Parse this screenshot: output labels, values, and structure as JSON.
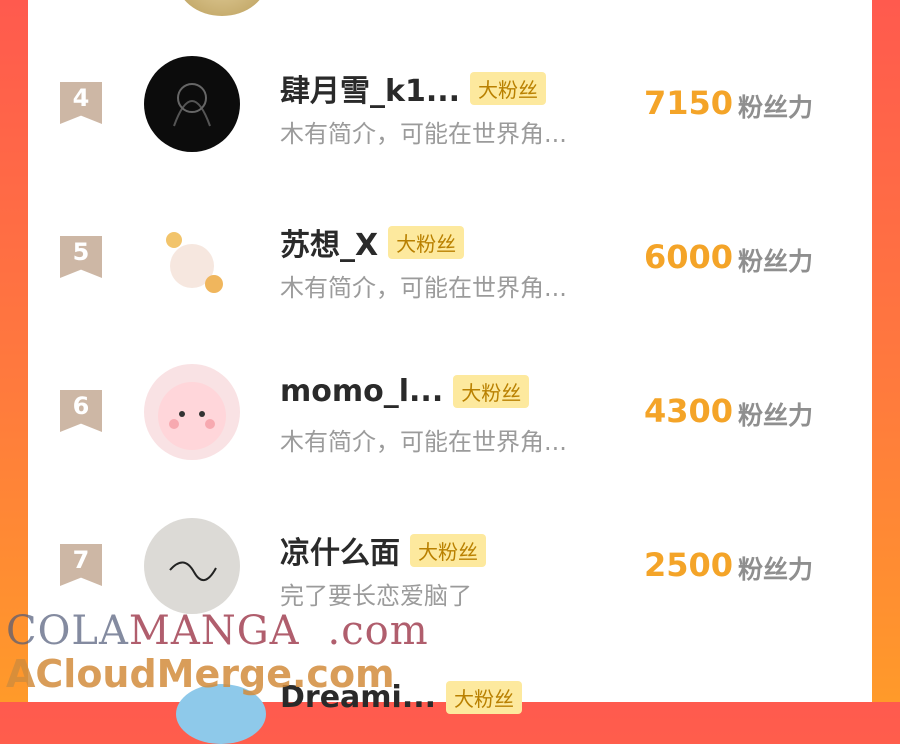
{
  "colors": {
    "accent": "#f4a428",
    "badge_bg": "#fde99e",
    "rank_bg": "#cdb7a5"
  },
  "leaderboard": {
    "rows": [
      {
        "rank": "4",
        "name": "肆月雪_k1...",
        "badge": "大粉丝",
        "bio": "木有简介，可能在世界角...",
        "score": "7150",
        "unit": "粉丝力"
      },
      {
        "rank": "5",
        "name": "苏想_X",
        "badge": "大粉丝",
        "bio": "木有简介，可能在世界角...",
        "score": "6000",
        "unit": "粉丝力"
      },
      {
        "rank": "6",
        "name": "momo_l...",
        "badge": "大粉丝",
        "bio": "木有简介，可能在世界角...",
        "score": "4300",
        "unit": "粉丝力"
      },
      {
        "rank": "7",
        "name": "凉什么面",
        "badge": "大粉丝",
        "bio": "完了要长恋爱脑了",
        "score": "2500",
        "unit": "粉丝力"
      }
    ],
    "partial_next": {
      "name": "Dreami...",
      "badge": "大粉丝"
    }
  },
  "watermark": {
    "line1_a": "COLA",
    "line1_b": "MANGA",
    "line1_c": ".com",
    "line2": "ACloudMerge.com"
  }
}
